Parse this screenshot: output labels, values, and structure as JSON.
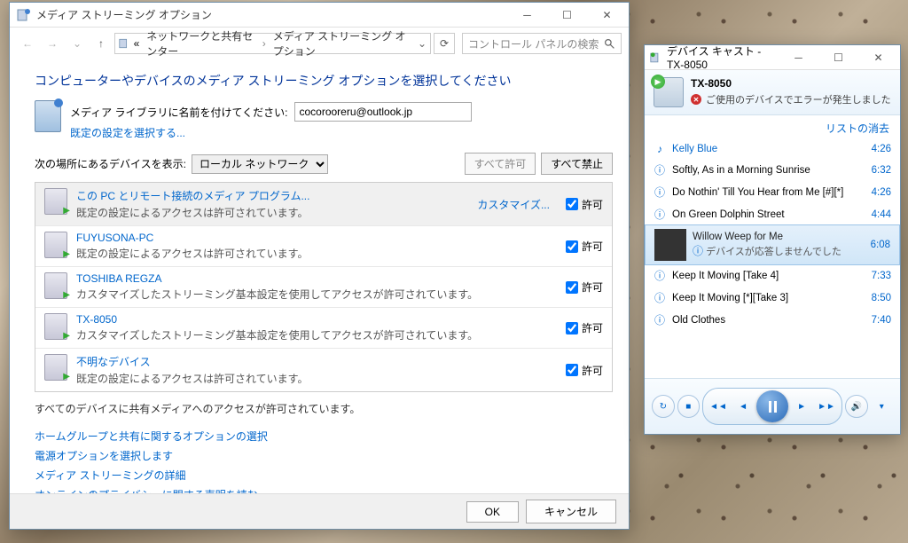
{
  "mainWin": {
    "title": "メディア ストリーミング オプション",
    "breadcrumb1": "ネットワークと共有センター",
    "breadcrumb2": "メディア ストリーミング オプション",
    "searchPlaceholder": "コントロール パネルの検索",
    "heading": "コンピューターやデバイスのメディア ストリーミング オプションを選択してください",
    "libLabel": "メディア ライブラリに名前を付けてください:",
    "libValue": "cocorooreru@outlook.jp",
    "libDefault": "既定の設定を選択する...",
    "locLabel": "次の場所にあるデバイスを表示:",
    "locOption": "ローカル ネットワーク",
    "allowAll": "すべて許可",
    "denyAll": "すべて禁止",
    "customize": "カスタマイズ...",
    "permitLabel": "許可",
    "statusMsg": "すべてのデバイスに共有メディアへのアクセスが許可されています。",
    "ok": "OK",
    "cancel": "キャンセル"
  },
  "devices": [
    {
      "name": "この PC とリモート接続のメディア プログラム...",
      "desc": "既定の設定によるアクセスは許可されています。",
      "customize": true
    },
    {
      "name": "FUYUSONA-PC",
      "desc": "既定の設定によるアクセスは許可されています。"
    },
    {
      "name": "TOSHIBA REGZA",
      "desc": "カスタマイズしたストリーミング基本設定を使用してアクセスが許可されています。"
    },
    {
      "name": "TX-8050",
      "desc": "カスタマイズしたストリーミング基本設定を使用してアクセスが許可されています。"
    },
    {
      "name": "不明なデバイス",
      "desc": "既定の設定によるアクセスは許可されています。"
    }
  ],
  "footerLinks": [
    "ホームグループと共有に関するオプションの選択",
    "電源オプションを選択します",
    "メディア ストリーミングの詳細",
    "オンラインのプライバシーに関する声明を読む"
  ],
  "cast": {
    "title": "デバイス キャスト - TX-8050",
    "devName": "TX-8050",
    "errMsg": "ご使用のデバイスでエラーが発生しました",
    "clear": "リストの消去"
  },
  "tracks": [
    {
      "name": "Kelly Blue",
      "dur": "4:26",
      "now": true
    },
    {
      "name": "Softly, As in a Morning Sunrise",
      "dur": "6:32"
    },
    {
      "name": "Do Nothin' Till You Hear from Me [#][*]",
      "dur": "4:26"
    },
    {
      "name": "On Green Dolphin Street",
      "dur": "4:44"
    },
    {
      "name": "Willow Weep for Me",
      "dur": "6:08",
      "sel": true,
      "err": "デバイスが応答しませんでした"
    },
    {
      "name": "Keep It Moving [Take 4]",
      "dur": "7:33"
    },
    {
      "name": "Keep It Moving [*][Take 3]",
      "dur": "8:50"
    },
    {
      "name": "Old Clothes",
      "dur": "7:40"
    }
  ]
}
